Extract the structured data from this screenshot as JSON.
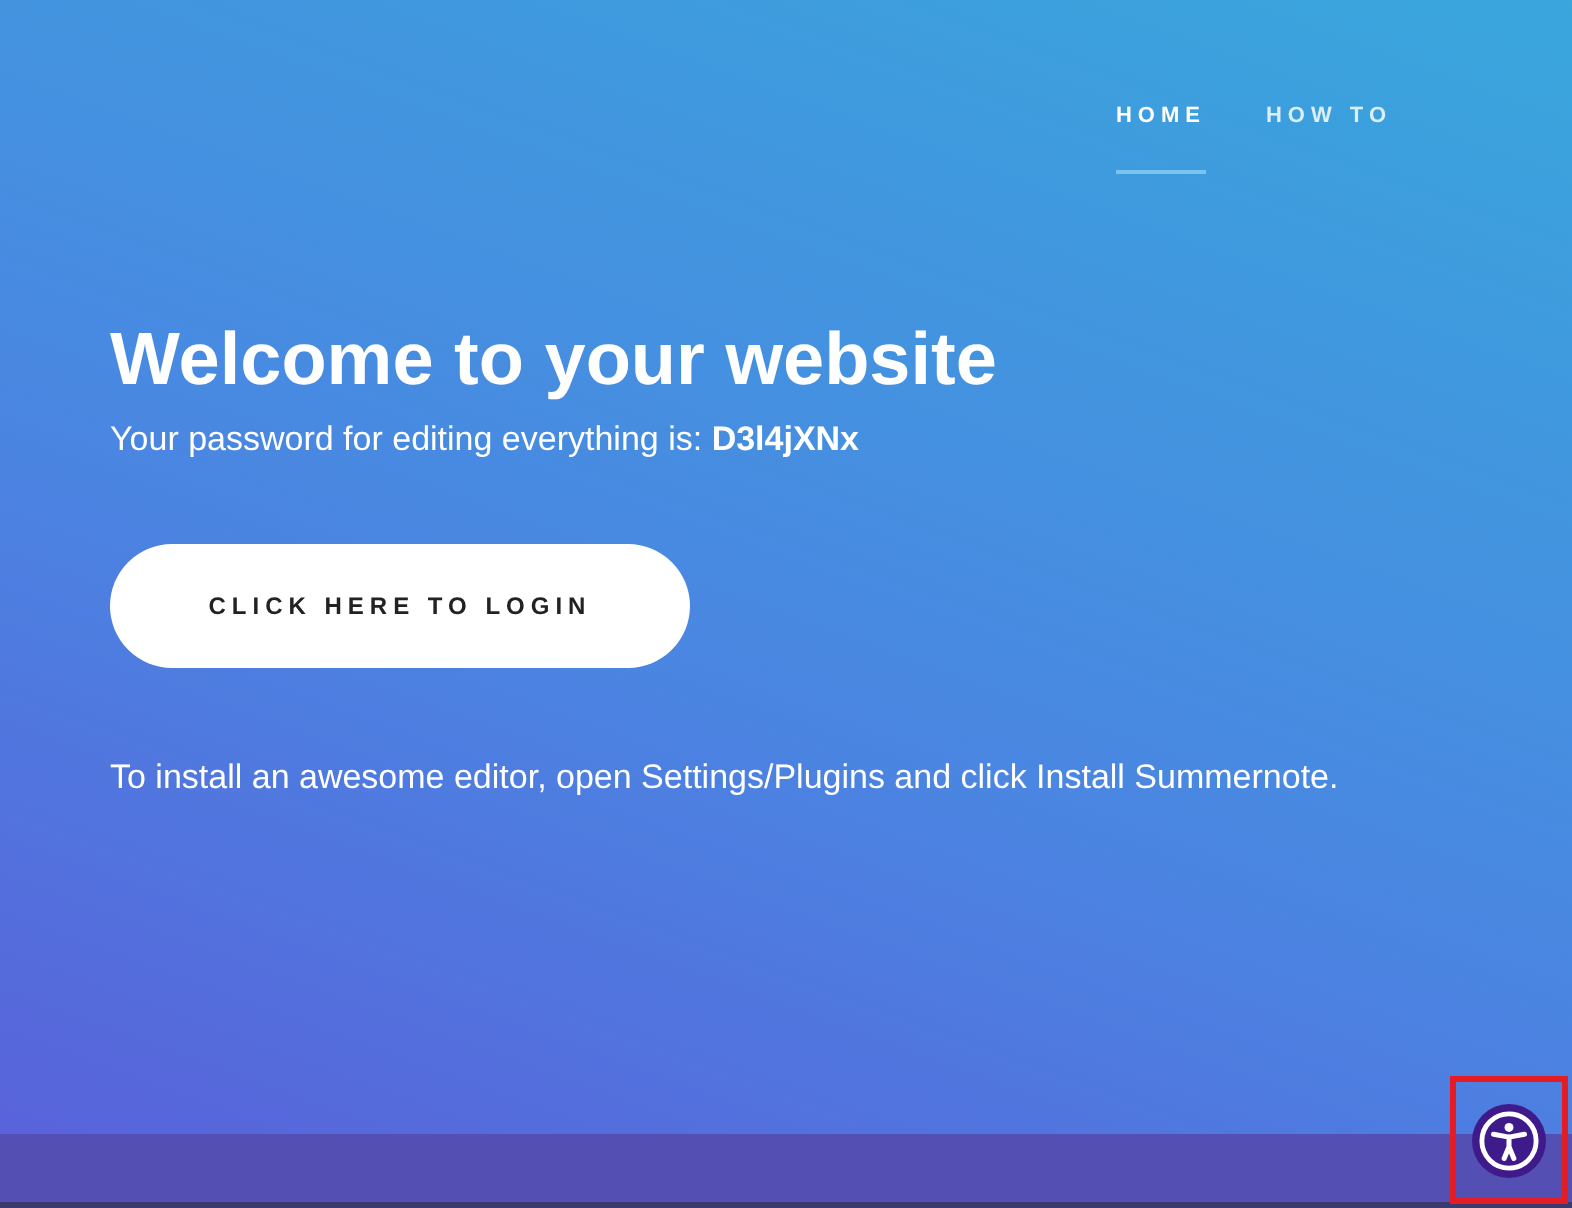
{
  "nav": [
    {
      "label": "HOME",
      "selected": true
    },
    {
      "label": "HOW TO",
      "selected": false
    }
  ],
  "hero": {
    "title": "Welcome to your website",
    "password_line": "Your password for editing everything is: **D3l4jXNx**",
    "login_button": "CLICK HERE TO LOGIN",
    "note": "To install an awesome editor, open Settings/Plugins and click Install Summernote."
  },
  "accessibility_button": {
    "highlighted": true
  }
}
